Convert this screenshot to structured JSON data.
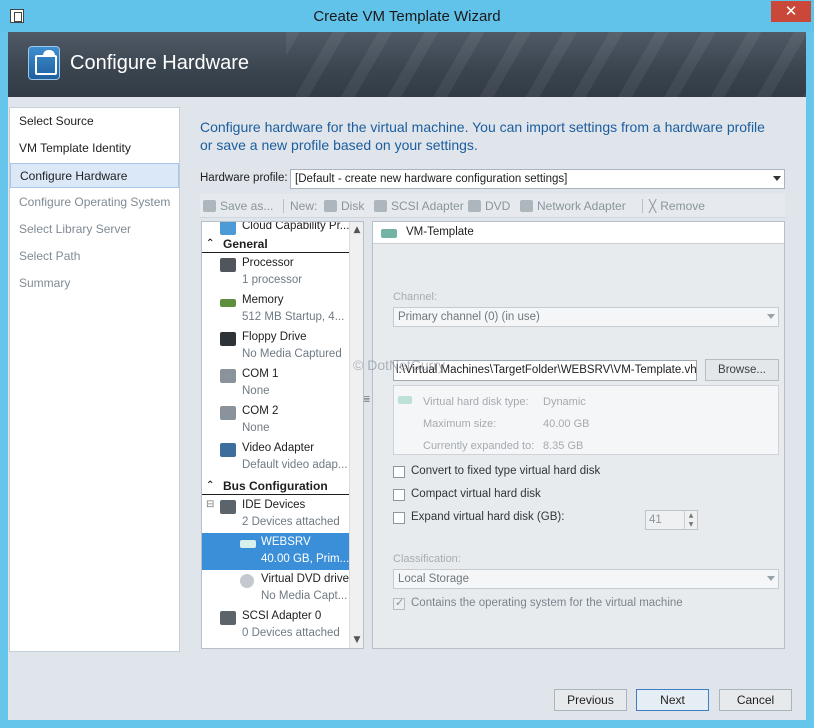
{
  "window": {
    "title": "Create VM Template Wizard",
    "close_glyph": "✕"
  },
  "banner": {
    "title": "Configure Hardware"
  },
  "nav": {
    "items": [
      {
        "label": "Select Source",
        "state": "normal"
      },
      {
        "label": "VM Template Identity",
        "state": "normal"
      },
      {
        "label": "Configure Hardware",
        "state": "active"
      },
      {
        "label": "Configure Operating System",
        "state": "disabled"
      },
      {
        "label": "Select Library Server",
        "state": "disabled"
      },
      {
        "label": "Select Path",
        "state": "disabled"
      },
      {
        "label": "Summary",
        "state": "disabled"
      }
    ]
  },
  "main": {
    "intro": "Configure hardware for the virtual machine. You can import settings from a hardware profile or save a new profile based on your settings.",
    "hardware_profile_label": "Hardware profile:",
    "hardware_profile_value": "[Default - create new hardware configuration settings]"
  },
  "toolbar": {
    "save_as": "Save as...",
    "new_label": "New:",
    "disk": "Disk",
    "scsi_adapter": "SCSI Adapter",
    "dvd": "DVD",
    "network_adapter": "Network Adapter",
    "remove": "Remove"
  },
  "tree": {
    "top_item": "Cloud Capability Pr...",
    "general_header": "General",
    "general": [
      {
        "name": "Processor",
        "sub": "1 processor",
        "icon": "processor-icon"
      },
      {
        "name": "Memory",
        "sub": "512 MB Startup, 4...",
        "icon": "memory-icon"
      },
      {
        "name": "Floppy Drive",
        "sub": "No Media Captured",
        "icon": "floppy-icon"
      },
      {
        "name": "COM 1",
        "sub": "None",
        "icon": "com-port-icon"
      },
      {
        "name": "COM 2",
        "sub": "None",
        "icon": "com-port-icon"
      },
      {
        "name": "Video Adapter",
        "sub": "Default video adap...",
        "icon": "video-adapter-icon"
      }
    ],
    "bus_header": "Bus Configuration",
    "ide": {
      "name": "IDE Devices",
      "sub": "2 Devices attached",
      "expander": "⊟"
    },
    "websrv": {
      "name": "WEBSRV",
      "sub": "40.00 GB, Prim..."
    },
    "dvd": {
      "name": "Virtual DVD drive",
      "sub": "No Media Capt..."
    },
    "scsi": {
      "name": "SCSI Adapter 0",
      "sub": "0 Devices attached"
    },
    "scroll_up": "▲",
    "scroll_down": "▼"
  },
  "details": {
    "header": "VM-Template",
    "channel_label": "Channel:",
    "channel_value": "Primary channel (0) (in use)",
    "path_value": "l:\\Virtual Machines\\TargetFolder\\WEBSRV\\VM-Template.vhdx",
    "browse": "Browse...",
    "vhd_type_label": "Virtual hard disk type:",
    "vhd_type_value": "Dynamic",
    "max_size_label": "Maximum size:",
    "max_size_value": "40.00 GB",
    "expanded_label": "Currently expanded to:",
    "expanded_value": "8.35 GB",
    "convert_label": "Convert to fixed type virtual hard disk",
    "compact_label": "Compact virtual hard disk",
    "expand_label": "Expand virtual hard disk (GB):",
    "expand_value": "41",
    "classification_label": "Classification:",
    "classification_value": "Local Storage",
    "contains_os_label": "Contains the operating system for the virtual machine",
    "contains_os_checked": true
  },
  "watermark": "© DotNetCurry",
  "footer": {
    "previous": "Previous",
    "next": "Next",
    "cancel": "Cancel"
  }
}
